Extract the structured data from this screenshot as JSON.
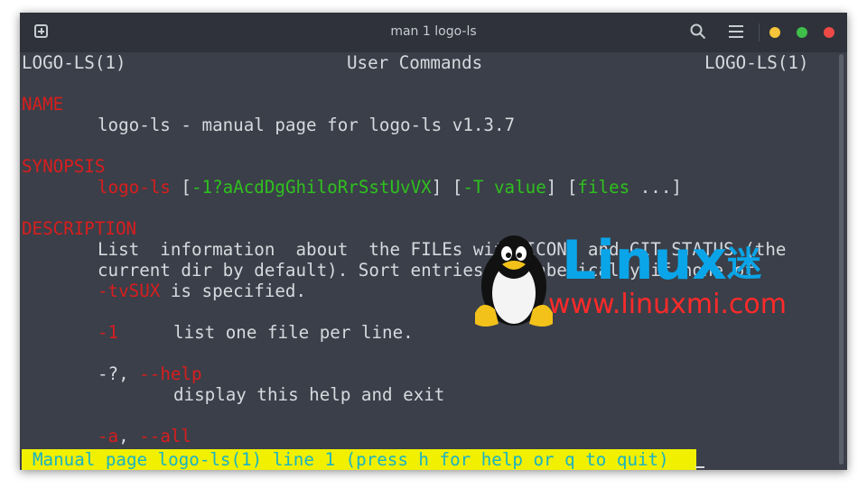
{
  "window": {
    "title": "man 1 logo-ls"
  },
  "icons": {
    "new_tab": "new-tab-icon",
    "search": "search-icon",
    "menu": "hamburger-menu-icon"
  },
  "colors": {
    "heading": "#d81e1e",
    "option": "#2fc01f",
    "status_bg": "#f0f000",
    "status_fg": "#19b2c6",
    "watermark_blue": "#0aa5e8",
    "watermark_red": "#ff2a2a"
  },
  "man": {
    "header_left": "LOGO-LS(1)",
    "header_center": "User Commands",
    "header_right": "LOGO-LS(1)",
    "name_heading": "NAME",
    "name_desc": "logo-ls - manual page for logo-ls v1.3.7",
    "synopsis_heading": "SYNOPSIS",
    "synopsis_cmd": "logo-ls",
    "synopsis_p1": " [",
    "synopsis_opt1": "-1?aAcdDgGhiloRrSstUvVX",
    "synopsis_p2": "] [",
    "synopsis_opt2": "-T value",
    "synopsis_p3": "] [",
    "synopsis_opt3": "files",
    "synopsis_p4": " ...]",
    "description_heading": "DESCRIPTION",
    "desc_line1": "List  information  about  the FILEs with ICONS and GIT STATUS (the",
    "desc_line2": "current dir by default). Sort entries alphabetically if none of",
    "desc_opt": "-tvSUX",
    "desc_line3_rest": " is specified.",
    "opt1_flag": "-1",
    "opt1_desc": "list one file per line.",
    "help_flag_plain": "-?, ",
    "help_flag": "--help",
    "help_desc": "display this help and exit",
    "all_flag1": "-a",
    "all_sep": ", ",
    "all_flag2": "--all"
  },
  "status": {
    "text": "Manual page logo-ls(1) line 1 (press h for help or q to quit)"
  },
  "watermark": {
    "brand": "Linux",
    "brand_char": "迷",
    "url": "www.linuxmi.com"
  }
}
